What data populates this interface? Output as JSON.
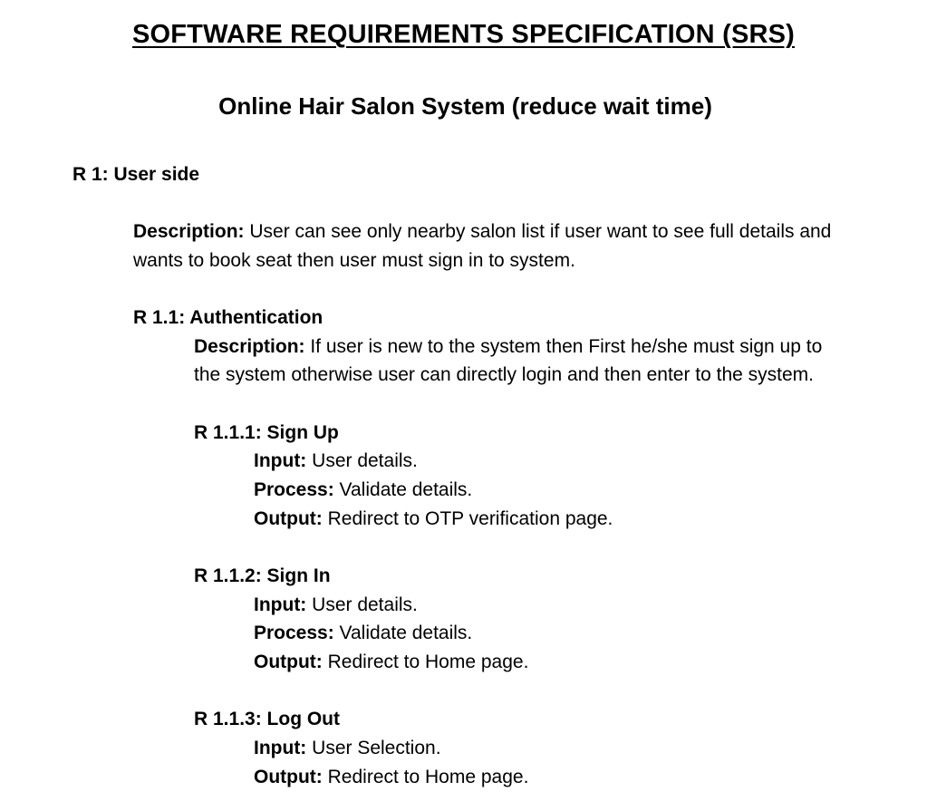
{
  "document": {
    "title": "SOFTWARE REQUIREMENTS SPECIFICATION (SRS)",
    "subtitle": "Online Hair Salon System (reduce wait time)"
  },
  "r1": {
    "heading": "R 1: User side",
    "description_label": "Description:",
    "description_line1": " User can see only nearby salon list if user want to see full details and",
    "description_line2": "wants to book seat then user must sign in to system."
  },
  "r11": {
    "heading": "R 1.1: Authentication",
    "description_label": "Description:",
    "description_line1": " If user is new to the system then First he/she must sign up to",
    "description_line2": "the system otherwise user can directly login and then enter to the system."
  },
  "r111": {
    "heading": "R 1.1.1: Sign Up",
    "input_label": "Input:",
    "input_value": " User details.",
    "process_label": "Process:",
    "process_value": " Validate details.",
    "output_label": "Output:",
    "output_value": " Redirect to OTP verification page."
  },
  "r112": {
    "heading": "R 1.1.2: Sign In",
    "input_label": "Input:",
    "input_value": " User details.",
    "process_label": "Process:",
    "process_value": " Validate details.",
    "output_label": "Output:",
    "output_value": " Redirect to Home page."
  },
  "r113": {
    "heading": "R 1.1.3: Log Out",
    "input_label": "Input:",
    "input_value": " User Selection.",
    "output_label": "Output:",
    "output_value": " Redirect to Home page."
  }
}
